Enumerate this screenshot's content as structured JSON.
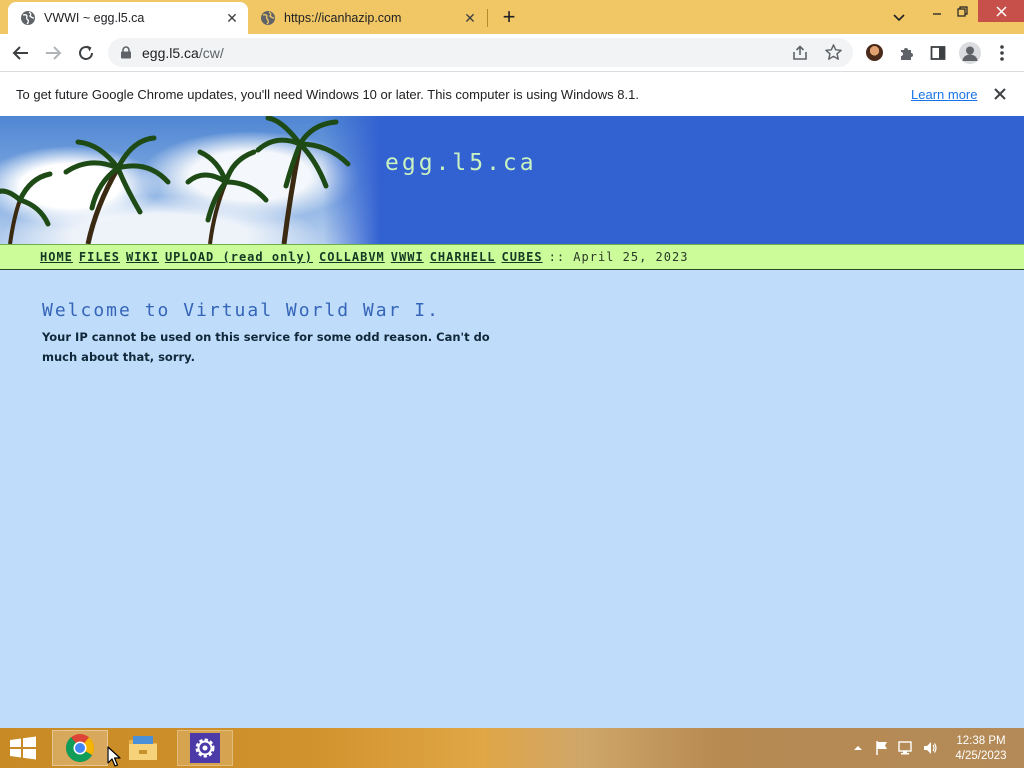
{
  "browser": {
    "tabs": [
      {
        "title": "VWWI ~ egg.l5.ca",
        "active": true
      },
      {
        "title": "https://icanhazip.com",
        "active": false
      }
    ],
    "omnibox": {
      "host": "egg.l5.ca",
      "path": "/cw/"
    }
  },
  "infobar": {
    "message": "To get future Google Chrome updates, you'll need Windows 10 or later. This computer is using Windows 8.1.",
    "link": "Learn more"
  },
  "page": {
    "site_title": "egg.l5.ca",
    "nav": [
      "HOME",
      "FILES",
      "WIKI",
      "UPLOAD (read only)",
      "COLLABVM",
      "VWWI",
      "CHARHELL",
      "CUBES"
    ],
    "date": ":: April 25, 2023",
    "heading": "Welcome to Virtual World War I.",
    "body": "Your IP cannot be used on this service for some odd reason. Can't do much about that, sorry."
  },
  "taskbar": {
    "apps": [
      "chrome-icon",
      "file-explorer-icon",
      "settings-icon"
    ],
    "clock": {
      "time": "12:38 PM",
      "date": "4/25/2023"
    }
  },
  "colors": {
    "tab_strip": "#f1c765",
    "banner": "#3261d1",
    "nav_bar": "#ccfc99",
    "page_background": "#bfdcfa",
    "heading": "#3565b8"
  }
}
